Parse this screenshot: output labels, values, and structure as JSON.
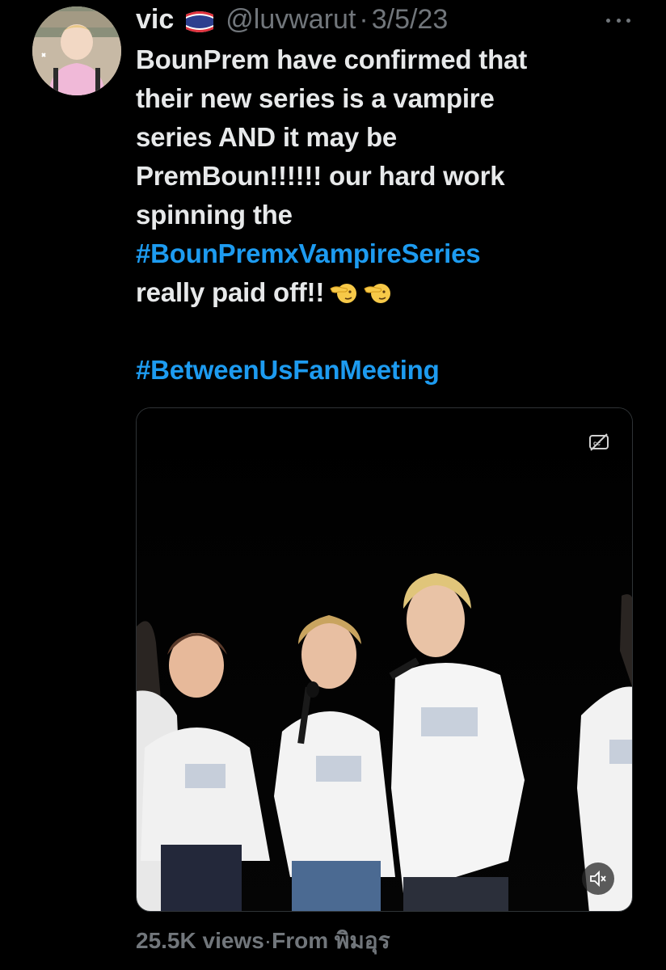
{
  "tweet": {
    "author": {
      "display_name": "vic",
      "flag_icon": "thailand-flag-icon",
      "handle": "@luvwarut",
      "separator": "·",
      "date": "3/5/23"
    },
    "more_icon": "more-horizontal-icon",
    "text_lines": [
      "BounPrem have confirmed that",
      "their new series is a vampire",
      "series AND it may be",
      "PremBoun!!!!!! our hard work",
      "spinning the"
    ],
    "hashtag_1": "#BounPremxVampireSeries",
    "line_after_hashtag": "really paid off!!",
    "emoji": "hand-pointing-face-emoji",
    "hashtag_2": "#BetweenUsFanMeeting",
    "media": {
      "type": "video",
      "cc_icon": "captions-off-icon",
      "mute_icon": "volume-muted-icon"
    },
    "footer": {
      "views_count": "25.5K",
      "views_label": " views",
      "separator": "·",
      "source_prefix": "From ",
      "source_app": "พิมอุร"
    }
  },
  "colors": {
    "background": "#000000",
    "text": "#e7e9ea",
    "muted": "#71767b",
    "link": "#1d9bf0"
  }
}
